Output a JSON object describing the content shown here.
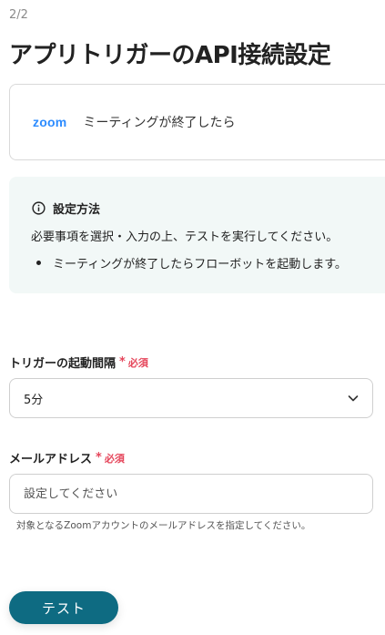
{
  "header": {
    "step": "2/2",
    "title": "アプリトリガーのAPI接続設定"
  },
  "app_card": {
    "logo_text": "zoom",
    "trigger_name": "ミーティングが終了したら"
  },
  "info_box": {
    "icon": "info-circle-icon",
    "title": "設定方法",
    "description": "必要事項を選択・入力の上、テストを実行してください。",
    "bullets": [
      "ミーティングが終了したらフローボットを起動します。"
    ]
  },
  "fields": {
    "interval": {
      "label": "トリガーの起動間隔",
      "required_mark": "*",
      "required_text": "必須",
      "selected_value": "5分",
      "icon": "chevron-down-icon"
    },
    "email": {
      "label": "メールアドレス",
      "required_mark": "*",
      "required_text": "必須",
      "value": "",
      "placeholder": "設定してください",
      "helper": "対象となるZoomアカウントのメールアドレスを指定してください。"
    }
  },
  "actions": {
    "test_label": "テスト"
  },
  "colors": {
    "accent": "#0e6b82",
    "required": "#e5455a",
    "zoom_brand": "#2d8cff",
    "info_bg": "#f2f8f7"
  }
}
